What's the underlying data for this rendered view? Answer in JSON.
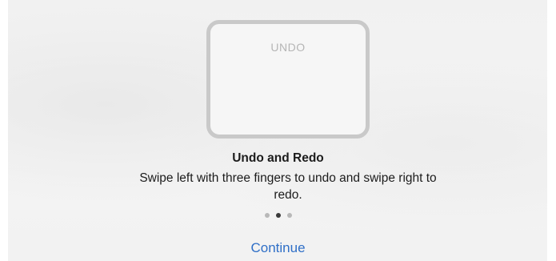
{
  "illustration": {
    "label": "UNDO"
  },
  "content": {
    "title": "Undo and Redo",
    "description": "Swipe left with three fingers to undo and swipe right to redo."
  },
  "pagination": {
    "count": 3,
    "active_index": 1
  },
  "actions": {
    "continue_label": "Continue"
  },
  "colors": {
    "accent": "#2f6fc7",
    "text": "#1c1c1c",
    "dot_inactive": "#b8b8b8",
    "dot_active": "#3a3a3a"
  }
}
